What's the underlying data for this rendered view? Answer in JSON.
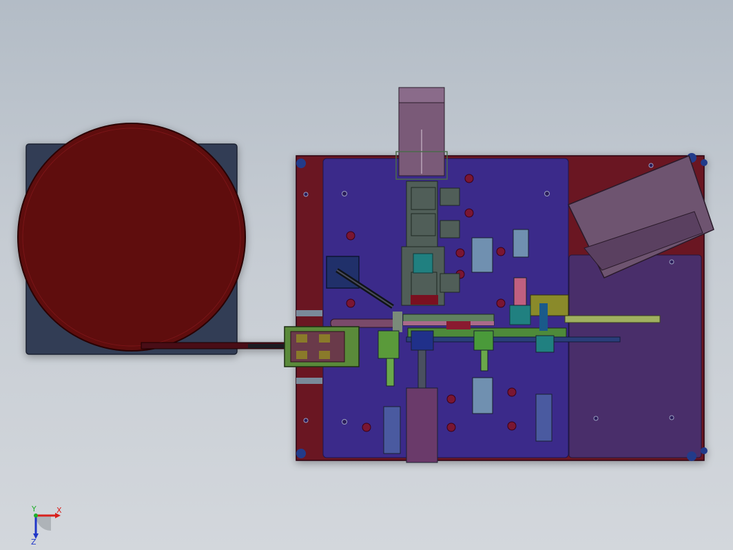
{
  "viewport": {
    "background_top": "#b3bcc6",
    "background_bottom": "#d3d7dc"
  },
  "triad": {
    "x_label": "X",
    "y_label": "Y",
    "z_label": "Z",
    "x_color": "#d8201c",
    "y_color": "#1fae2a",
    "z_color": "#2036c8"
  },
  "model": {
    "bowl_feeder": {
      "bowl_color": "#5e0b0e",
      "base_color": "#323d55"
    },
    "main_plate": {
      "frame_color": "#6a1422",
      "plate_color": "#3a2a8a",
      "right_plate_color": "#4a2e6a"
    },
    "icons": [
      "rotate-view-triad-icon"
    ]
  }
}
